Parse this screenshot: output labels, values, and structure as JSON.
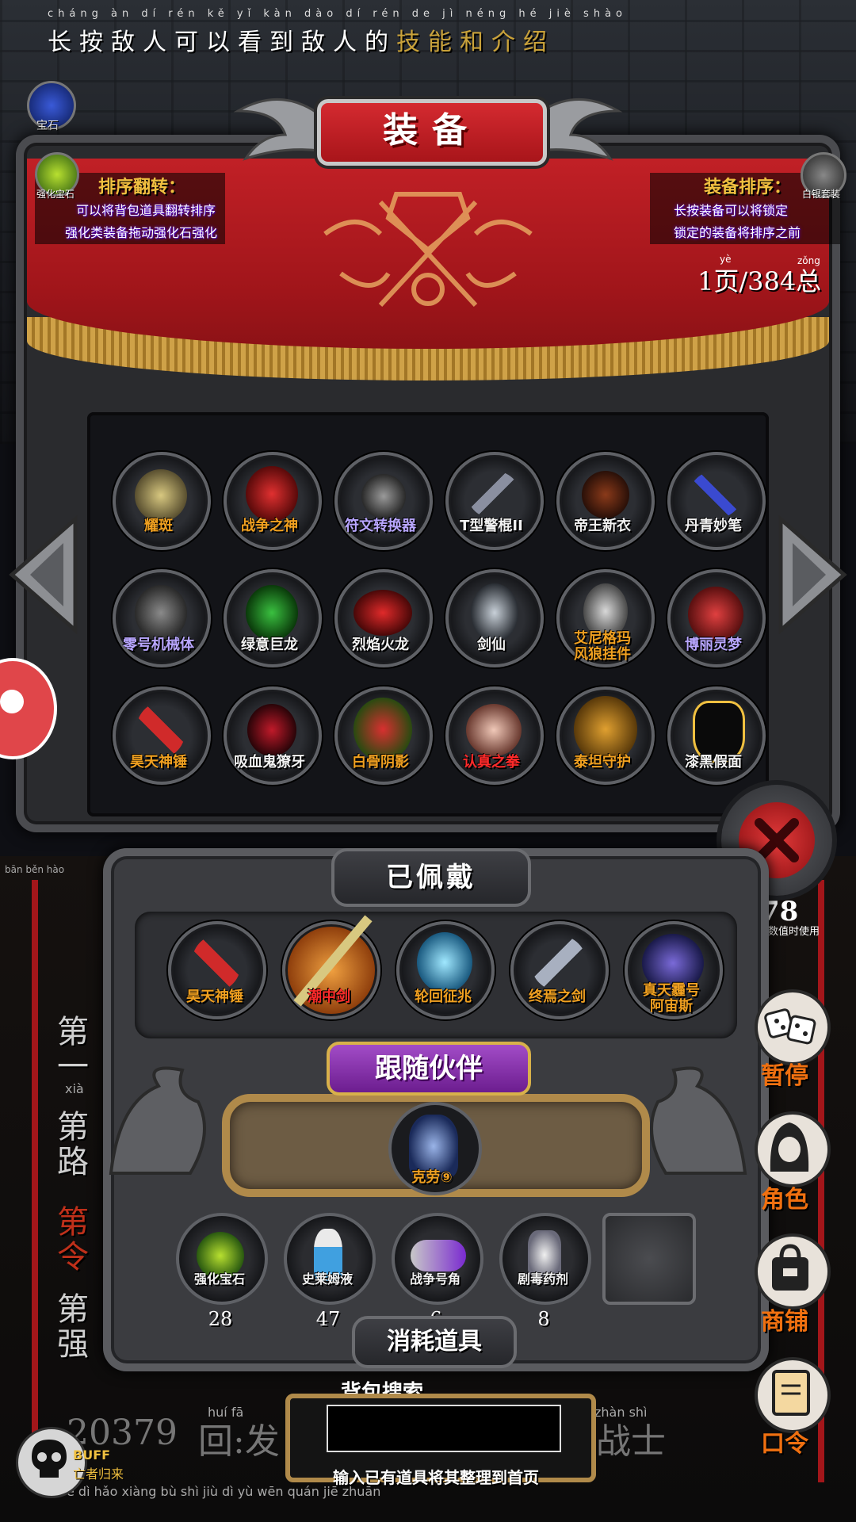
{
  "tip": {
    "pinyin": "cháng àn dí rén kě yǐ kàn dào dí rén de jì néng hé jiè shào",
    "text_main": "长按敌人可以看到敌人的",
    "text_em": "技能和介绍"
  },
  "top_left": {
    "gem_label": "宝石",
    "enhance_label": "强化宝石"
  },
  "top_right": {
    "set_label": "白银套装"
  },
  "title": "装备",
  "info_left": {
    "heading": "排序翻转：",
    "line1": "可以将背包道具翻转排序",
    "line2": "强化类装备拖动强化石强化"
  },
  "info_right": {
    "heading": "装备排序：",
    "line1": "长按装备可以将锁定",
    "line2": "锁定的装备将排序之前"
  },
  "pager": {
    "text": "1页/384总",
    "ruby_ye": "yè",
    "ruby_zong": "zǒng"
  },
  "inventory": [
    {
      "name": "耀斑",
      "color": "orange"
    },
    {
      "name": "战争之神",
      "color": "orange"
    },
    {
      "name": "符文转换器",
      "color": "purple"
    },
    {
      "name": "T型警棍II",
      "color": "white"
    },
    {
      "name": "帝王新衣",
      "color": "white"
    },
    {
      "name": "丹青妙笔",
      "color": "white"
    },
    {
      "name": "零号机械体",
      "color": "purple"
    },
    {
      "name": "绿意巨龙",
      "color": "white"
    },
    {
      "name": "烈焰火龙",
      "color": "white"
    },
    {
      "name": "剑仙",
      "color": "white"
    },
    {
      "name": "艾尼格玛\n风狼挂件",
      "color": "orange"
    },
    {
      "name": "博丽灵梦",
      "color": "purple"
    },
    {
      "name": "昊天神锤",
      "color": "orange"
    },
    {
      "name": "吸血鬼獠牙",
      "color": "white"
    },
    {
      "name": "白骨阴影",
      "color": "orange"
    },
    {
      "name": "认真之拳",
      "color": "red"
    },
    {
      "name": "泰坦守护",
      "color": "orange"
    },
    {
      "name": "漆黑假面",
      "color": "white"
    }
  ],
  "equipped": {
    "title": "已佩戴",
    "items": [
      {
        "name": "昊天神锤",
        "color": "orange"
      },
      {
        "name": "潮中剑",
        "color": "red"
      },
      {
        "name": "轮回征兆",
        "color": "orange"
      },
      {
        "name": "终焉之剑",
        "color": "orange"
      },
      {
        "name": "真天霾号\n阿宙斯",
        "color": "orange"
      }
    ]
  },
  "companion": {
    "title": "跟随伙伴",
    "name": "克劳⑨"
  },
  "consumables": {
    "title": "消耗道具",
    "items": [
      {
        "name": "强化宝石",
        "count": "28"
      },
      {
        "name": "史莱姆液",
        "count": "47"
      },
      {
        "name": "战争号角",
        "count": "6"
      },
      {
        "name": "剧毒药剂",
        "count": "8"
      }
    ]
  },
  "right_menu": {
    "partial_number": "78",
    "partial_note": "其数值时使用",
    "pause": "暂停",
    "role": "角色",
    "shop": "商铺",
    "code": "口令"
  },
  "left_chapters": {
    "pinyin_top": "bān běn hào",
    "ch1": "第一",
    "ch1_ruby": "xià",
    "ch2": "第路",
    "ch3": "第令",
    "ch4": "第强"
  },
  "search": {
    "label": "背包搜索",
    "placeholder": "",
    "hint": "输入已有道具将其整理到首页"
  },
  "bottom": {
    "left_number": "20379",
    "pinyin_huifa": "huí fā",
    "reply": "回:发",
    "pinyin_zhanshi": "zhàn shì",
    "warrior": "战士",
    "pinyin_line": "è dì hǎo xiàng bù shì jiù dì yù wēn quán jiē zhuān",
    "buff_label": "BUFF",
    "buff_sub": "亡者归来"
  },
  "colors": {
    "orange": "#f0a020",
    "purple": "#b8a6ff",
    "white": "#f2f2f2",
    "red": "#ff2a2a",
    "banner_red": "#c12026",
    "accent_gold": "#d8a849"
  }
}
